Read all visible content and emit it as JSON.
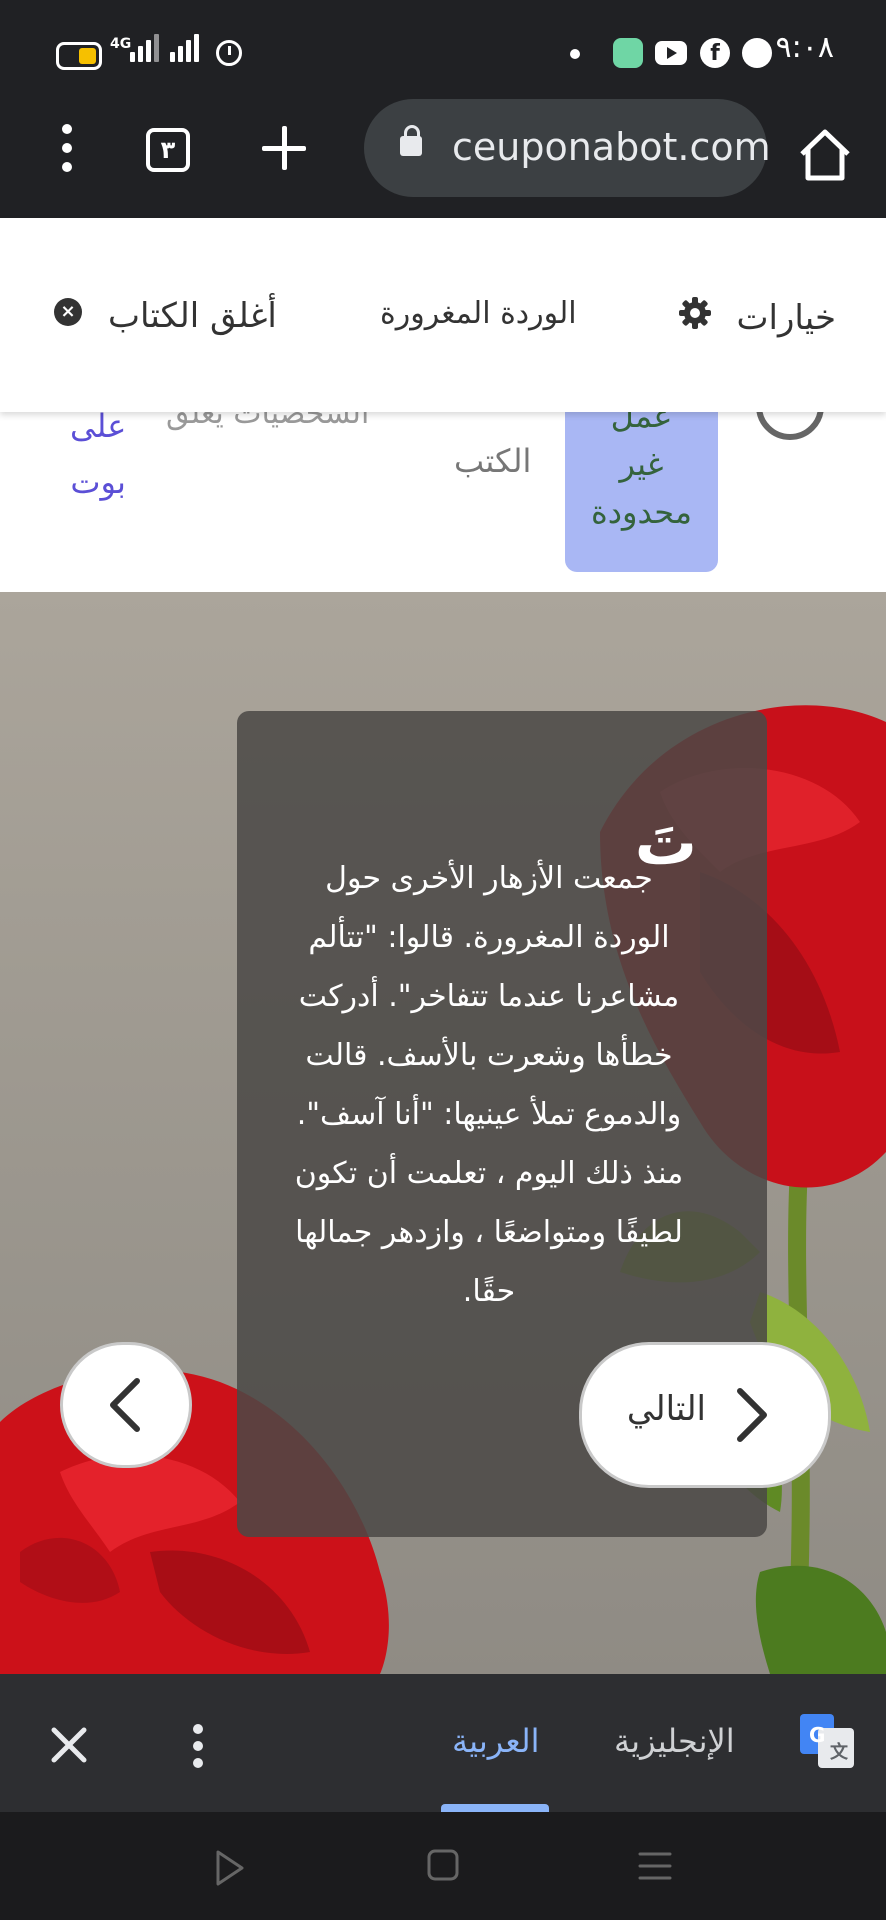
{
  "status_bar": {
    "time": "٩:٠٨",
    "network": "4G",
    "icons": [
      "battery-icon",
      "signal-icon",
      "alarm-icon",
      "dot-icon",
      "duo-icon",
      "youtube-icon",
      "facebook-icon",
      "game-icon"
    ]
  },
  "browser": {
    "url": "ceuponabot.com",
    "tab_count": "٣",
    "icons": [
      "home-icon",
      "lock-icon",
      "new-tab-icon",
      "tabs-icon",
      "more-icon"
    ]
  },
  "book_bar": {
    "options_label": "خيارات",
    "book_title": "الوردة المغرورة",
    "close_label": "أغلق الكتاب"
  },
  "strip": {
    "promo_lines": [
      "عمل",
      "غير",
      "محدودة"
    ],
    "books_label": "الكتب",
    "faded_text": "الشخصيات يعلق",
    "link_lines": [
      "على",
      "بوت"
    ]
  },
  "story": {
    "drop_cap": "تَ",
    "text": "جمعت الأزهار الأخرى حول الوردة المغرورة. قالوا: \"تتألم مشاعرنا عندما تتفاخر\". أدركت خطأها وشعرت بالأسف. قالت والدموع تملأ عينيها: \"أنا آسف\". منذ ذلك اليوم ، تعلمت أن تكون لطيفًا ومتواضعًا ، وازدهر جمالها حقًا.",
    "next_label": "التالي"
  },
  "translate_bar": {
    "lang_source": "الإنجليزية",
    "lang_target": "العربية"
  },
  "colors": {
    "browser_bg": "#202124",
    "accent_blue": "#8ab4f8",
    "promo_bg": "#a9b7f4",
    "rose_red": "#d4111b"
  }
}
